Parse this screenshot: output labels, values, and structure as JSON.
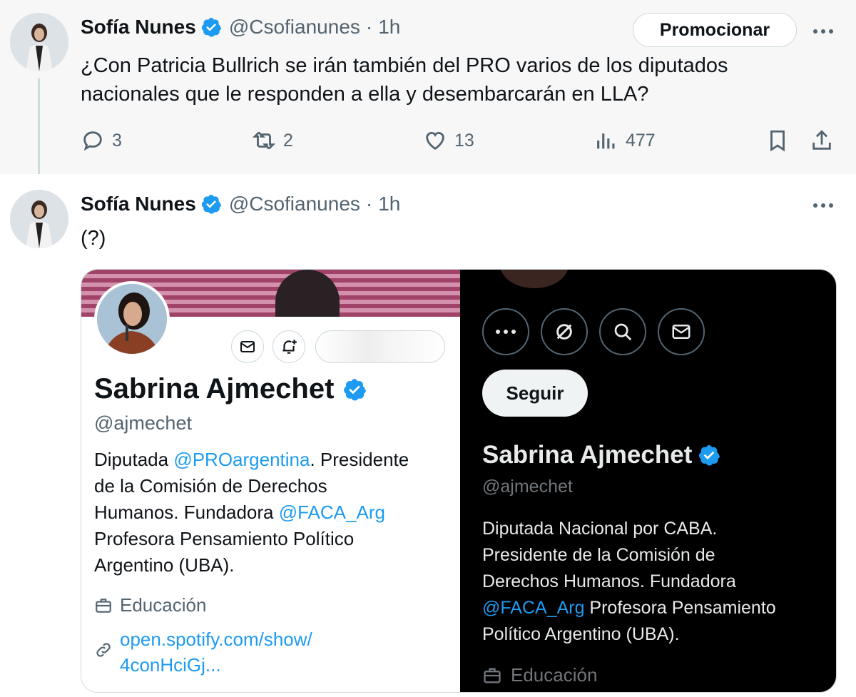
{
  "tweet1": {
    "author": "Sofía Nunes",
    "handle": "@Csofianunes",
    "separator": "·",
    "time": "1h",
    "promote_label": "Promocionar",
    "text_line1": "¿Con Patricia Bullrich se irán también del PRO varios de los diputados",
    "text_line2": "nacionales que le responden a ella y desembarcarán en LLA?",
    "replies": "3",
    "reposts": "2",
    "likes": "13",
    "views": "477"
  },
  "tweet2": {
    "author": "Sofía Nunes",
    "handle": "@Csofianunes",
    "separator": "·",
    "time": "1h",
    "text": "(?)"
  },
  "card_left": {
    "name": "Sabrina Ajmechet",
    "handle": "@ajmechet",
    "bio_1": "Diputada ",
    "bio_mention_1": "@PROargentina",
    "bio_2": ". Presidente",
    "bio_3": "de la Comisión de Derechos",
    "bio_4": "Humanos. Fundadora ",
    "bio_mention_2": "@FACA_Arg",
    "bio_5": "Profesora Pensamiento Político",
    "bio_6": "Argentino (UBA).",
    "category": "Educación",
    "link_line1": "open.spotify.com/show/",
    "link_line2": "4conHciGj..."
  },
  "card_right": {
    "follow_label": "Seguir",
    "name": "Sabrina Ajmechet",
    "handle": "@ajmechet",
    "bio_1": "Diputada Nacional por CABA.",
    "bio_2": "Presidente de la Comisión de",
    "bio_3": "Derechos Humanos. Fundadora",
    "bio_mention": "@FACA_Arg",
    "bio_4": " Profesora Pensamiento",
    "bio_5": "Político Argentino (UBA).",
    "category": "Educación"
  },
  "colors": {
    "accent": "#1d9bf0",
    "text": "#0f1419",
    "muted": "#536471",
    "dark_bg": "#000000"
  },
  "icons": [
    "verified-badge-icon",
    "more-icon",
    "reply-icon",
    "repost-icon",
    "like-icon",
    "views-icon",
    "bookmark-icon",
    "share-icon",
    "mail-icon",
    "bell-plus-icon",
    "briefcase-icon",
    "link-icon",
    "search-icon",
    "grok-icon"
  ]
}
